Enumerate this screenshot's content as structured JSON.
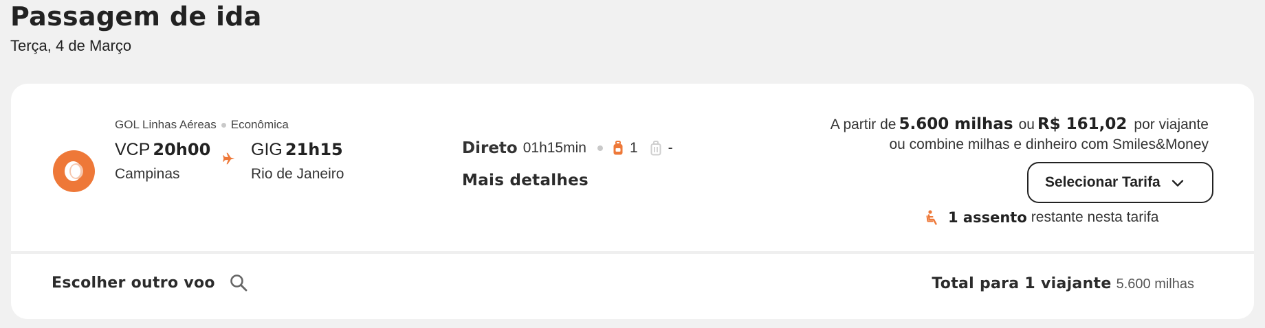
{
  "header": {
    "title": "Passagem de ida",
    "subtitle": "Terça, 4 de Março"
  },
  "flight": {
    "airline": "GOL Linhas Aéreas",
    "cabin": "Econômica",
    "origin": {
      "code": "VCP",
      "time": "20h00",
      "city": "Campinas"
    },
    "destination": {
      "code": "GIG",
      "time": "21h15",
      "city": "Rio de Janeiro"
    },
    "stops_label": "Direto",
    "duration": "01h15min",
    "carry_on_count": "1",
    "checked_bag_count": "-",
    "details_link": "Mais detalhes"
  },
  "pricing": {
    "prefix": "A partir de",
    "miles": "5.600 milhas",
    "or": "ou",
    "money": "R$ 161,02",
    "suffix": "por viajante",
    "combine_text": "ou combine milhas e dinheiro com Smiles&Money",
    "select_button": "Selecionar Tarifa",
    "seats_bold": "1 assento",
    "seats_rest": "restante nesta tarifa"
  },
  "footer": {
    "other_flight": "Escolher outro voo",
    "total_label": "Total para 1 viajante",
    "total_value": "5.600 milhas"
  },
  "colors": {
    "accent": "#ee7838",
    "background": "#f1f1f1",
    "card": "#ffffff"
  },
  "icons": [
    "plane-icon",
    "backpack-icon",
    "luggage-icon",
    "chevron-down-icon",
    "seat-icon",
    "search-icon"
  ]
}
